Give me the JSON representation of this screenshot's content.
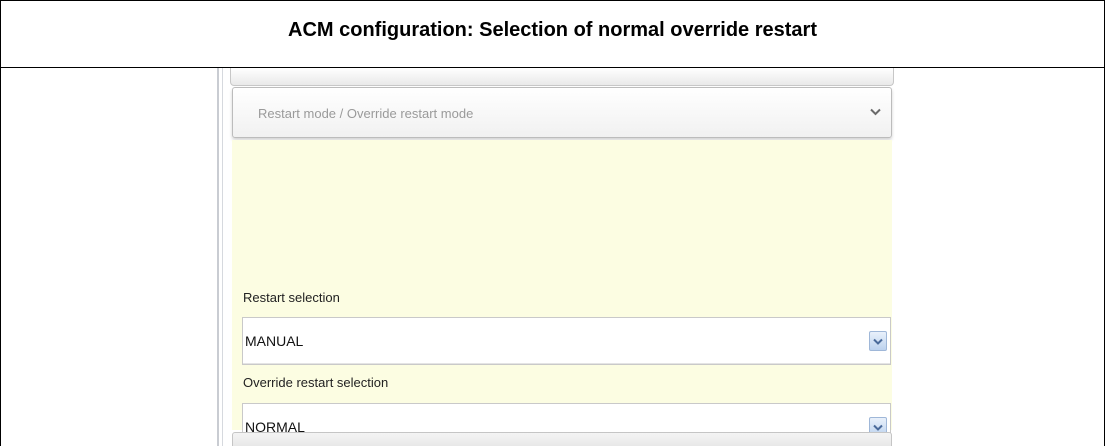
{
  "document": {
    "title": "ACM configuration: Selection of normal override restart"
  },
  "section": {
    "header_label": "Restart mode / Override restart mode",
    "header_icon": "chevron-down-icon",
    "body_color": "#fcfde2"
  },
  "fields": {
    "restart": {
      "label": "Restart selection",
      "value": "MANUAL",
      "arrow_icon": "dropdown-arrow-icon"
    },
    "override_restart": {
      "label": "Override restart selection",
      "value": "NORMAL",
      "arrow_icon": "dropdown-arrow-icon"
    }
  }
}
